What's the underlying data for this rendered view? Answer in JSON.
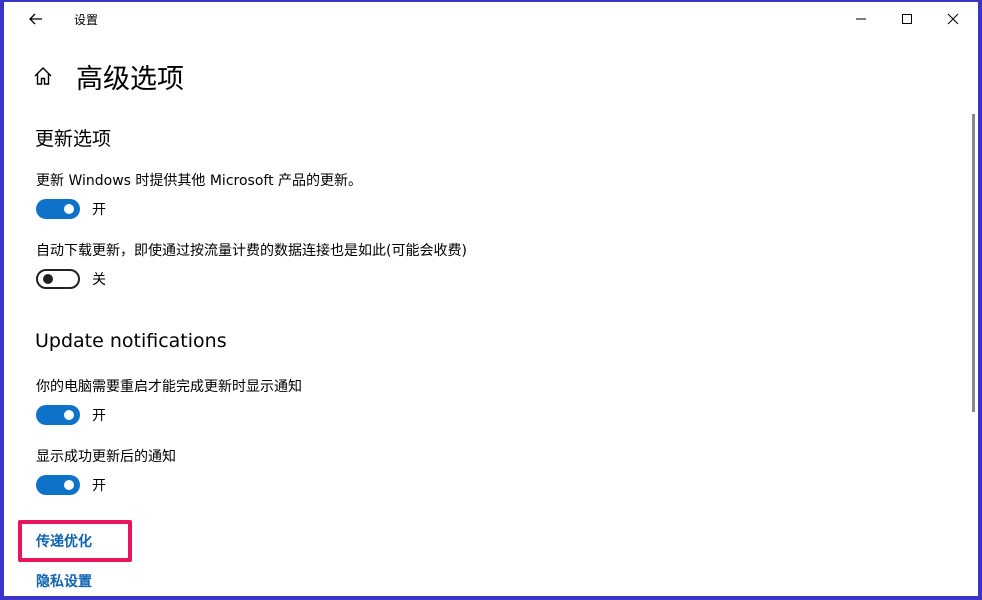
{
  "window": {
    "title": "设置"
  },
  "header": {
    "title": "高级选项"
  },
  "update_options": {
    "title": "更新选项",
    "settings": [
      {
        "label": "更新 Windows 时提供其他 Microsoft 产品的更新。",
        "state": "开"
      },
      {
        "label": "自动下载更新，即使通过按流量计费的数据连接也是如此(可能会收费)",
        "state": "关"
      }
    ]
  },
  "update_notifications": {
    "title": "Update notifications",
    "settings": [
      {
        "label": "你的电脑需要重启才能完成更新时显示通知",
        "state": "开"
      },
      {
        "label": "显示成功更新后的通知",
        "state": "开"
      }
    ]
  },
  "links": {
    "delivery_optimization": "传递优化",
    "privacy_settings": "隐私设置"
  },
  "colors": {
    "accent": "#0f72c9",
    "link": "#0f63b0",
    "highlight": "#e8155e",
    "frame": "#3b34c9"
  }
}
